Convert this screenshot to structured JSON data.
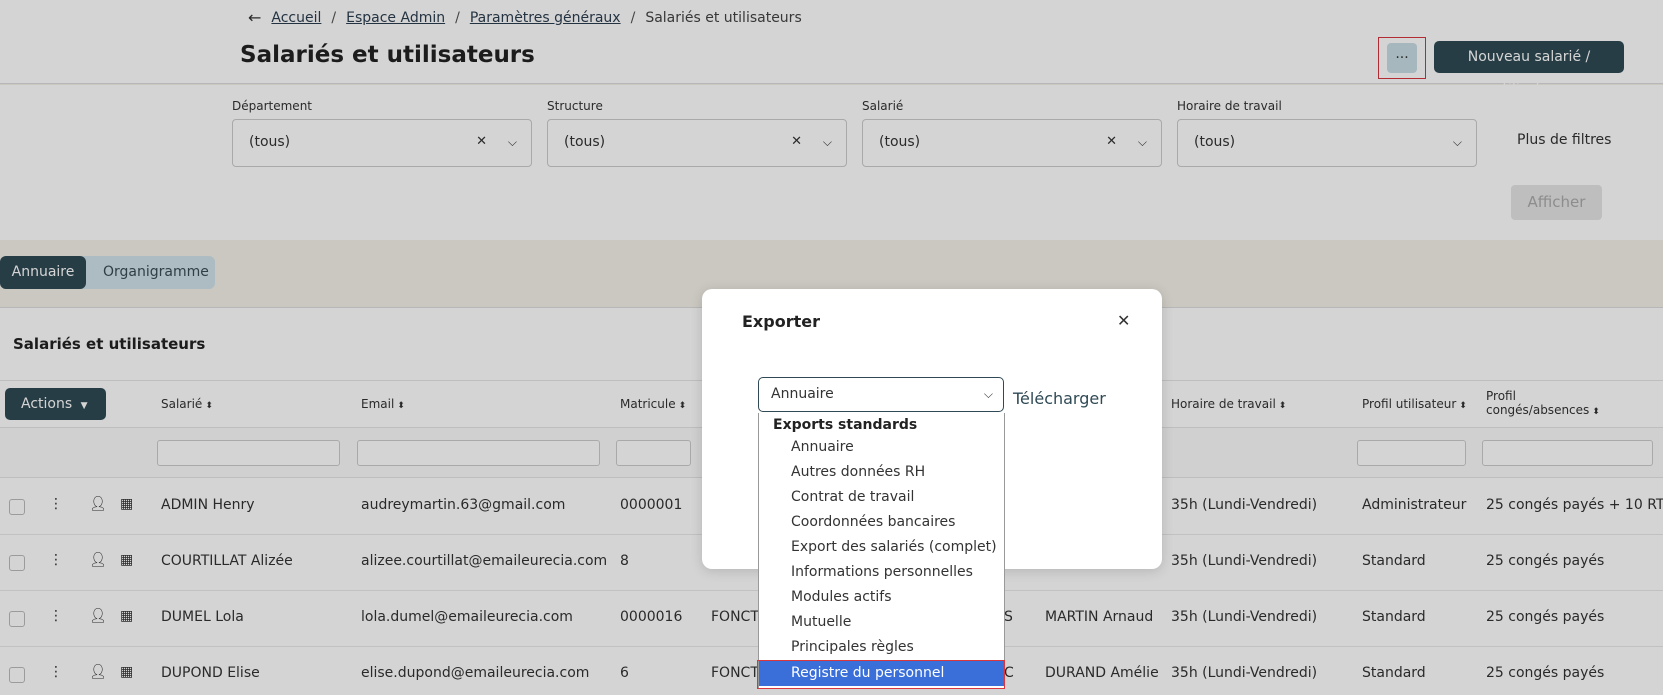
{
  "header": {
    "breadcrumb": {
      "back_icon": "arrow-left-icon",
      "items": [
        "Accueil",
        "Espace Admin",
        "Paramètres généraux"
      ],
      "separator": "/",
      "current": "Salariés et utilisateurs"
    },
    "title": "Salariés et utilisateurs",
    "more_label": "...",
    "new_button": "Nouveau salarié / utilisateur"
  },
  "filters": {
    "items": [
      {
        "label": "Département",
        "value": "(tous)",
        "clearable": true
      },
      {
        "label": "Structure",
        "value": "(tous)",
        "clearable": true
      },
      {
        "label": "Salarié",
        "value": "(tous)",
        "clearable": true
      },
      {
        "label": "Horaire de travail",
        "value": "(tous)",
        "clearable": false
      }
    ],
    "more_filters": "Plus de filtres",
    "show_button": "Afficher"
  },
  "tabs": [
    "Annuaire",
    "Organigramme"
  ],
  "panel": {
    "title": "Salariés et utilisateurs",
    "actions_button": "Actions",
    "columns": [
      "Salarié",
      "Email",
      "Matricule",
      "Horaire de travail",
      "Profil utilisateur",
      "Profil",
      "congés/absences"
    ],
    "rows": [
      {
        "name": "ADMIN Henry",
        "email": "audreymartin.63@gmail.com",
        "matricule": "0000001",
        "col4": "",
        "col5": "",
        "col6": "",
        "horaire": "35h (Lundi-Vendredi)",
        "profil": "Administrateur",
        "conges": "25 congés payés + 10 RTT"
      },
      {
        "name": "COURTILLAT Alizée",
        "email": "alizee.courtillat@emaileurecia.com",
        "matricule": "8",
        "col4": "",
        "col5": "",
        "col6": "",
        "horaire": "35h (Lundi-Vendredi)",
        "profil": "Standard",
        "conges": "25 congés payés"
      },
      {
        "name": "DUMEL Lola",
        "email": "lola.dumel@emaileurecia.com",
        "matricule": "0000016",
        "col4": "FONCT",
        "col5": "S",
        "col6": "MARTIN Arnaud",
        "horaire": "35h (Lundi-Vendredi)",
        "profil": "Standard",
        "conges": "25 congés payés"
      },
      {
        "name": "DUPOND Elise",
        "email": "elise.dupond@emaileurecia.com",
        "matricule": "6",
        "col4": "FONCT",
        "col5": "C",
        "col6": "DURAND Amélie",
        "horaire": "35h (Lundi-Vendredi)",
        "profil": "Standard",
        "conges": "25 congés payés"
      }
    ]
  },
  "modal": {
    "title": "Exporter",
    "close_icon": "close-icon",
    "select_value": "Annuaire",
    "download_label": "Télécharger",
    "dropdown": {
      "group": "Exports standards",
      "options": [
        "Annuaire",
        "Autres données RH",
        "Contrat de travail",
        "Coordonnées bancaires",
        "Export des salariés (complet)",
        "Informations personnelles",
        "Modules actifs",
        "Mutuelle",
        "Principales règles",
        "Registre du personnel"
      ],
      "highlighted": "Registre du personnel"
    }
  },
  "colors": {
    "primary": "#2f4a55",
    "tab_bg": "#cfe3ea",
    "highlight": "#3a6ed8",
    "outline": "#d9363e"
  }
}
